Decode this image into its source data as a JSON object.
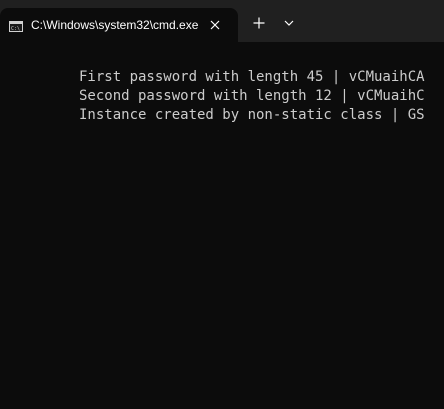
{
  "tab": {
    "title": "C:\\Windows\\system32\\cmd.exe",
    "icon": "cmd-icon"
  },
  "tabbar": {
    "close_icon": "close-icon",
    "new_tab_icon": "plus-icon",
    "dropdown_icon": "chevron-down-icon"
  },
  "console": {
    "lines": [
      "First password with length 45 | vCMuaihCA",
      "Second password with length 12 | vCMuaihC",
      "Instance created by non-static class | GS"
    ]
  },
  "colors": {
    "background": "#0c0c0c",
    "tabbar": "#202020",
    "text": "#cccccc"
  }
}
